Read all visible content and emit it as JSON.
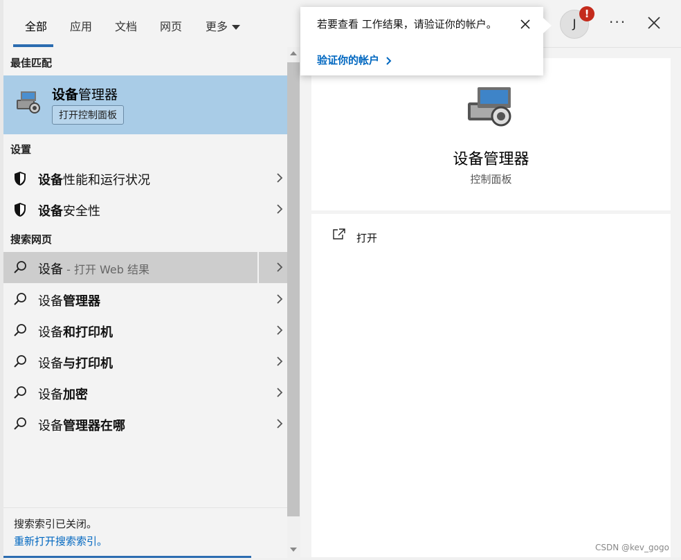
{
  "tabs": [
    {
      "label": "全部"
    },
    {
      "label": "应用"
    },
    {
      "label": "文档"
    },
    {
      "label": "网页"
    },
    {
      "label": "更多"
    }
  ],
  "avatar": {
    "initial": "J",
    "badge": "!"
  },
  "notification": {
    "message": "若要查看 工作结果，请验证你的帐户。",
    "link": "验证你的帐户"
  },
  "left": {
    "best_match_header": "最佳匹配",
    "best_match": {
      "title_bold": "设备",
      "title_rest": "管理器",
      "subtitle": "打开控制面板"
    },
    "settings_header": "设置",
    "settings": [
      {
        "bold": "设备",
        "rest": "性能和运行状况"
      },
      {
        "bold": "设备",
        "rest": "安全性"
      }
    ],
    "web_header": "搜索网页",
    "web_results": [
      {
        "plain": "设备",
        "bold": "",
        "dim": " - 打开 Web 结果"
      },
      {
        "plain": "设备",
        "bold": "管理器",
        "dim": ""
      },
      {
        "plain": "设备",
        "bold": "和打印机",
        "dim": ""
      },
      {
        "plain": "设备",
        "bold": "与打印机",
        "dim": ""
      },
      {
        "plain": "设备",
        "bold": "加密",
        "dim": ""
      },
      {
        "plain": "设备",
        "bold": "管理器在哪",
        "dim": ""
      }
    ],
    "footer_text": "搜索索引已关闭。",
    "footer_link": "重新打开搜索索引。"
  },
  "right": {
    "title": "设备管理器",
    "subtitle": "控制面板",
    "action_open": "打开"
  },
  "watermark": "CSDN @kev_gogo",
  "colors": {
    "accent": "#0067c0",
    "selected": "#a9cce7",
    "hover": "#cdcdcd",
    "badge": "#c42b1c"
  }
}
